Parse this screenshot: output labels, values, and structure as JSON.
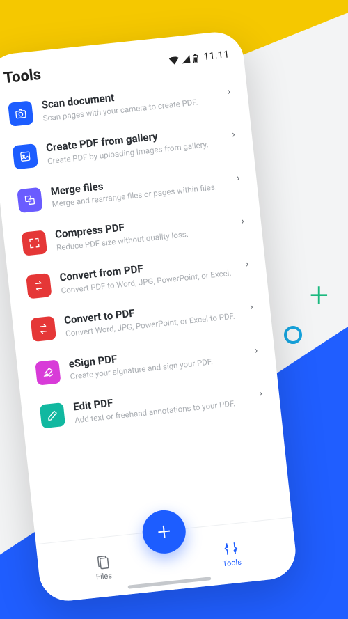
{
  "statusbar": {
    "title": "Tools",
    "time": "11:11"
  },
  "tools": [
    {
      "key": "scan",
      "icon": "camera",
      "color": "ic-blue",
      "title": "Scan document",
      "desc": "Scan pages with your camera to create PDF."
    },
    {
      "key": "gallery",
      "icon": "image",
      "color": "ic-blue",
      "title": "Create PDF from gallery",
      "desc": "Create PDF by uploading images from gallery."
    },
    {
      "key": "merge",
      "icon": "merge",
      "color": "ic-purple",
      "title": "Merge files",
      "desc": "Merge and rearrange files or pages within files."
    },
    {
      "key": "compress",
      "icon": "compress",
      "color": "ic-red",
      "title": "Compress PDF",
      "desc": "Reduce PDF size without quality loss."
    },
    {
      "key": "convfrom",
      "icon": "convert",
      "color": "ic-red",
      "title": "Convert from PDF",
      "desc": "Convert PDF to Word, JPG, PowerPoint, or Excel."
    },
    {
      "key": "convto",
      "icon": "convert",
      "color": "ic-red",
      "title": "Convert to PDF",
      "desc": "Convert Word, JPG, PowerPoint, or Excel to PDF."
    },
    {
      "key": "esign",
      "icon": "sign",
      "color": "ic-magenta",
      "title": "eSign PDF",
      "desc": "Create your signature and sign your PDF."
    },
    {
      "key": "edit",
      "icon": "edit",
      "color": "ic-teal",
      "title": "Edit PDF",
      "desc": "Add text or freehand annotations to your PDF."
    }
  ],
  "nav": {
    "files": "Files",
    "tools": "Tools",
    "fab": "+"
  }
}
